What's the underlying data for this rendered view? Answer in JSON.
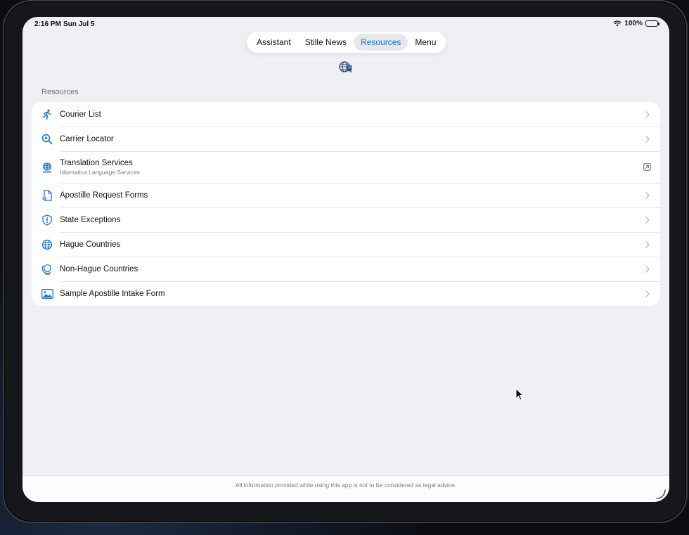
{
  "status_bar": {
    "time": "2:16 PM",
    "date": "Sun Jul 5",
    "battery": "100%"
  },
  "tabs": [
    {
      "label": "Assistant",
      "active": false
    },
    {
      "label": "Stille News",
      "active": false
    },
    {
      "label": "Resources",
      "active": true
    },
    {
      "label": "Menu",
      "active": false
    }
  ],
  "section_title": "Resources",
  "resources": [
    {
      "title": "Courier List",
      "icon": "running-person-icon",
      "accessory": "chevron"
    },
    {
      "title": "Carrier Locator",
      "icon": "magnifier-locator-icon",
      "accessory": "chevron"
    },
    {
      "title": "Translation Services",
      "subtitle": "Idiomatica Language Services",
      "icon": "idiomatica-logo-icon",
      "accessory": "external-link"
    },
    {
      "title": "Apostille Request Forms",
      "icon": "document-gear-icon",
      "accessory": "chevron"
    },
    {
      "title": "State Exceptions",
      "icon": "shield-exclamation-icon",
      "accessory": "chevron"
    },
    {
      "title": "Hague Countries",
      "icon": "globe-icon",
      "accessory": "chevron"
    },
    {
      "title": "Non-Hague Countries",
      "icon": "globe-stand-icon",
      "accessory": "chevron"
    },
    {
      "title": "Sample Apostille Intake Form",
      "icon": "photo-icon",
      "accessory": "chevron"
    }
  ],
  "footer_text": "All information provided while using this app is not to be considered as legal advice.",
  "colors": {
    "accent": "#1b74d1",
    "background": "#eff0f4",
    "card": "#ffffff"
  }
}
